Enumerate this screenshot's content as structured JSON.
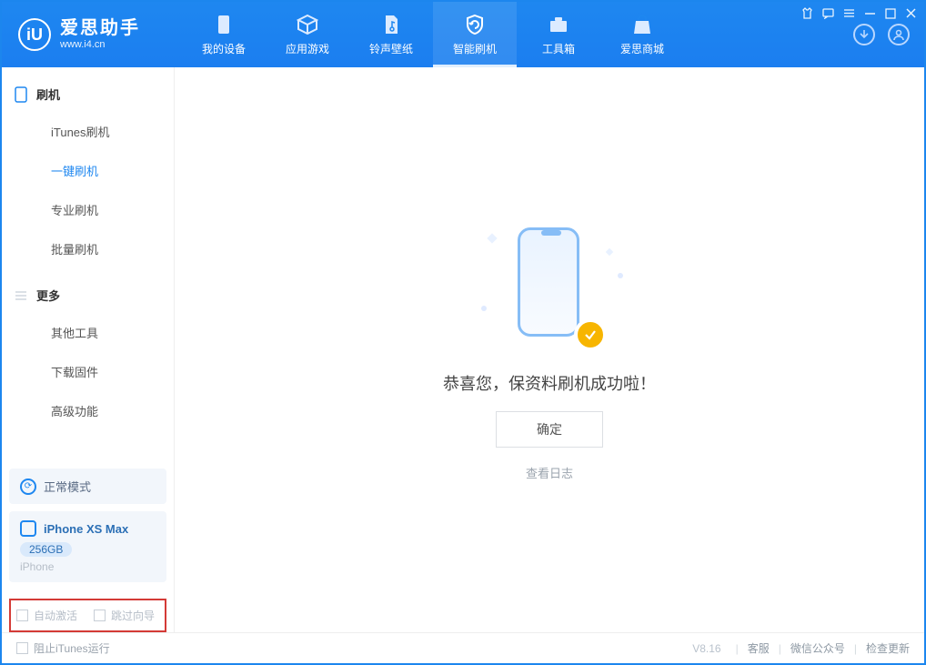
{
  "app": {
    "name": "爱思助手",
    "url": "www.i4.cn"
  },
  "tabs": [
    {
      "label": "我的设备"
    },
    {
      "label": "应用游戏"
    },
    {
      "label": "铃声壁纸"
    },
    {
      "label": "智能刷机"
    },
    {
      "label": "工具箱"
    },
    {
      "label": "爱思商城"
    }
  ],
  "sidebar": {
    "section_flash": "刷机",
    "flash_items": [
      {
        "label": "iTunes刷机"
      },
      {
        "label": "一键刷机"
      },
      {
        "label": "专业刷机"
      },
      {
        "label": "批量刷机"
      }
    ],
    "section_more": "更多",
    "more_items": [
      {
        "label": "其他工具"
      },
      {
        "label": "下载固件"
      },
      {
        "label": "高级功能"
      }
    ]
  },
  "status": {
    "mode": "正常模式",
    "device": "iPhone XS Max",
    "capacity": "256GB",
    "type": "iPhone"
  },
  "options": {
    "auto_activate": "自动激活",
    "skip_guide": "跳过向导"
  },
  "main": {
    "success": "恭喜您，保资料刷机成功啦！",
    "ok": "确定",
    "view_log": "查看日志"
  },
  "footer": {
    "block_itunes": "阻止iTunes运行",
    "version": "V8.16",
    "support": "客服",
    "wechat": "微信公众号",
    "update": "检查更新"
  }
}
